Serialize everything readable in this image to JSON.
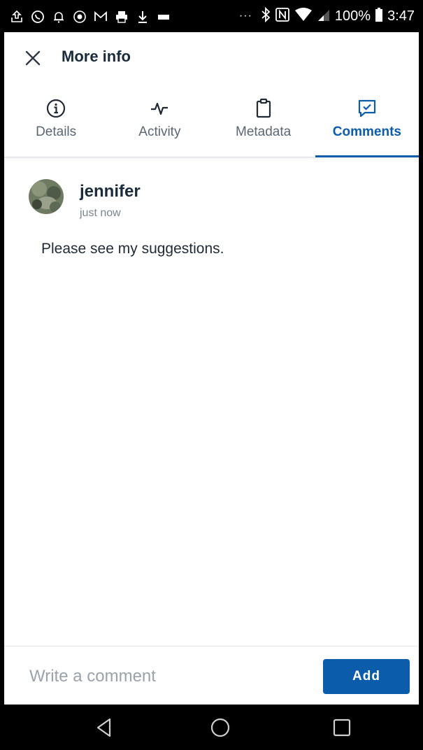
{
  "status_bar": {
    "battery": "100%",
    "time": "3:47",
    "overflow": "···"
  },
  "header": {
    "title": "More info"
  },
  "tabs": [
    {
      "label": "Details",
      "icon": "info-icon",
      "active": false
    },
    {
      "label": "Activity",
      "icon": "activity-icon",
      "active": false
    },
    {
      "label": "Metadata",
      "icon": "clipboard-icon",
      "active": false
    },
    {
      "label": "Comments",
      "icon": "comment-check-icon",
      "active": true
    }
  ],
  "comments": [
    {
      "author": "jennifer",
      "timestamp": "just now",
      "text": "Please see my suggestions."
    }
  ],
  "input_bar": {
    "placeholder": "Write a comment",
    "add_label": "Add"
  },
  "colors": {
    "accent": "#0b5cab",
    "text_dark": "#1a2b3c",
    "text_muted": "#5a6672"
  }
}
